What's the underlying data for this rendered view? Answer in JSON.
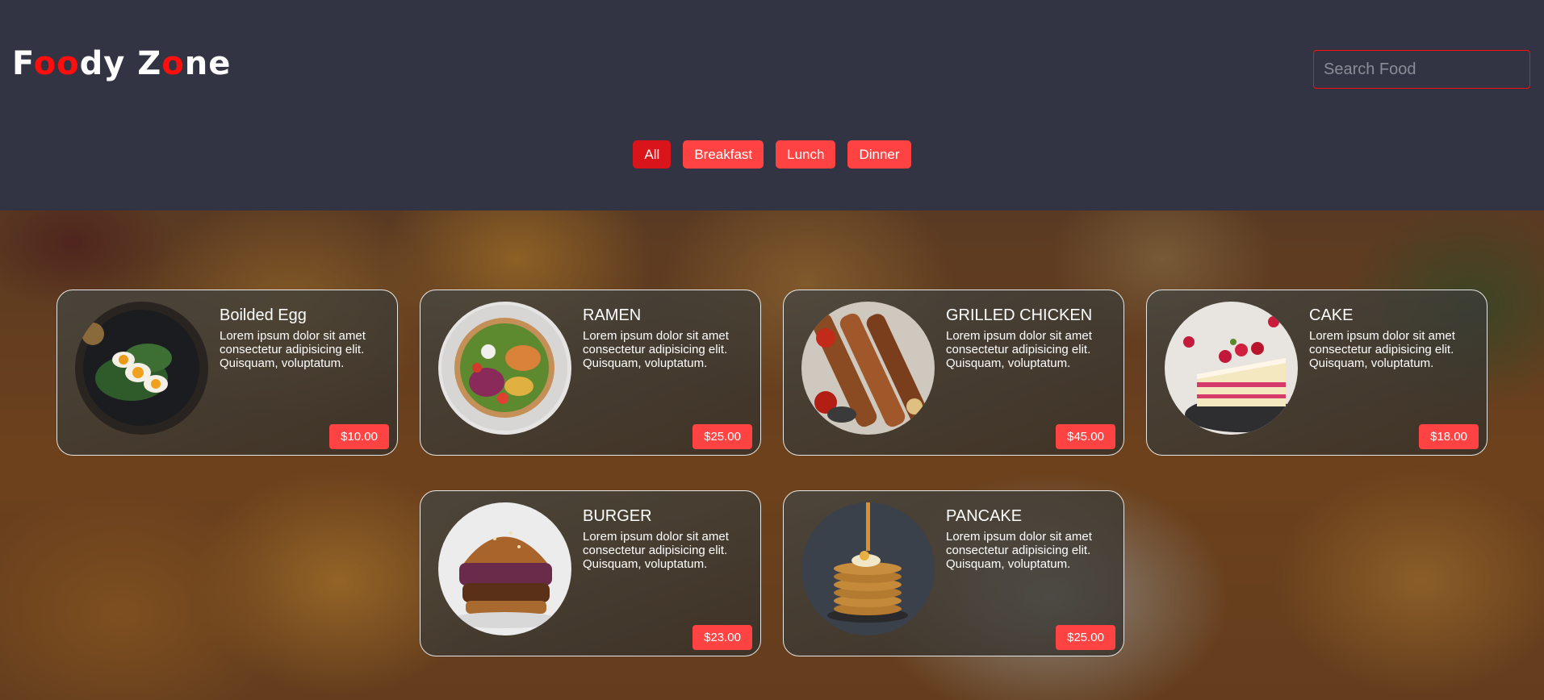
{
  "logo": {
    "part1": "F",
    "part2": "oo",
    "part3": "dy Z",
    "part4": "o",
    "part5": "ne"
  },
  "search": {
    "placeholder": "Search Food"
  },
  "filters": [
    "All",
    "Breakfast",
    "Lunch",
    "Dinner"
  ],
  "cards": [
    {
      "title": "Boilded Egg",
      "desc": "Lorem ipsum dolor sit amet consectetur adipisicing elit. Quisquam, voluptatum.",
      "price": "$10.00",
      "image": "boiled-egg-plate"
    },
    {
      "title": "RAMEN",
      "desc": "Lorem ipsum dolor sit amet consectetur adipisicing elit. Quisquam, voluptatum.",
      "price": "$25.00",
      "image": "ramen-bowl"
    },
    {
      "title": "GRILLED CHICKEN",
      "desc": "Lorem ipsum dolor sit amet consectetur adipisicing elit. Quisquam, voluptatum.",
      "price": "$45.00",
      "image": "grilled-chicken-skewers"
    },
    {
      "title": "CAKE",
      "desc": "Lorem ipsum dolor sit amet consectetur adipisicing elit. Quisquam, voluptatum.",
      "price": "$18.00",
      "image": "cake-slice"
    },
    {
      "title": "BURGER",
      "desc": "Lorem ipsum dolor sit amet consectetur adipisicing elit. Quisquam, voluptatum.",
      "price": "$23.00",
      "image": "burger"
    },
    {
      "title": "PANCAKE",
      "desc": "Lorem ipsum dolor sit amet consectetur adipisicing elit. Quisquam, voluptatum.",
      "price": "$25.00",
      "image": "pancake-stack"
    }
  ],
  "colors": {
    "header_bg": "#323443",
    "accent": "#ff4343",
    "accent_active": "#d9141a",
    "logo_red": "#ff0e0e"
  }
}
